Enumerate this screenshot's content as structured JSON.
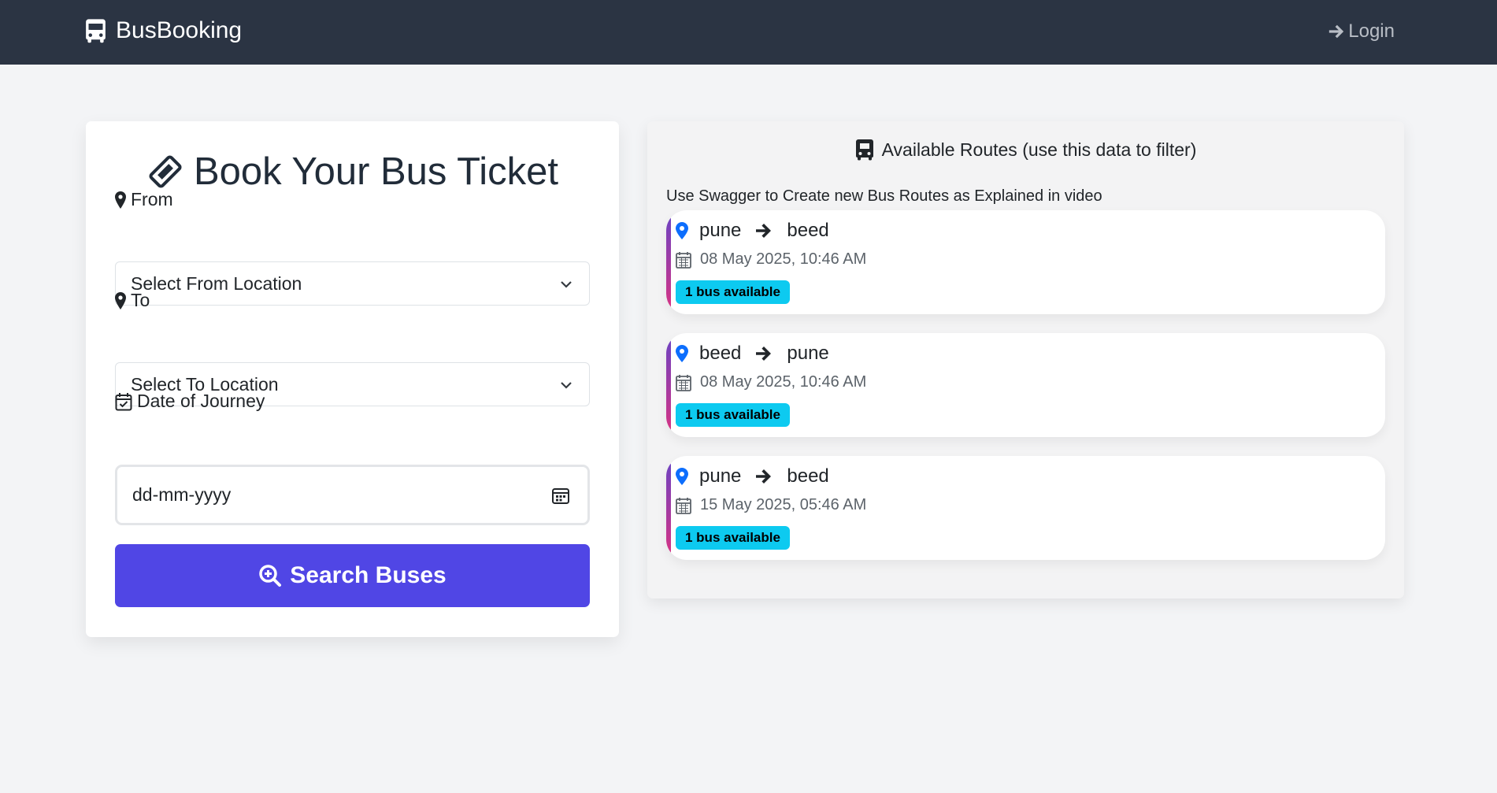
{
  "navbar": {
    "brand": "BusBooking",
    "login": "Login"
  },
  "booking": {
    "title": "Book Your Bus Ticket",
    "from_label": "From",
    "from_value": "Select From Location",
    "to_label": "To",
    "to_value": "Select To Location",
    "date_label": "Date of Journey",
    "date_placeholder": "dd-mm-yyyy",
    "search_label": "Search Buses"
  },
  "routes": {
    "title": "Available Routes (use this data to filter)",
    "note": "Use Swagger to Create new Bus Routes as Explained in video",
    "items": [
      {
        "from": "pune",
        "to": "beed",
        "datetime": "08 May 2025, 10:46 AM",
        "badge": "1 bus available"
      },
      {
        "from": "beed",
        "to": "pune",
        "datetime": "08 May 2025, 10:46 AM",
        "badge": "1 bus available"
      },
      {
        "from": "pune",
        "to": "beed",
        "datetime": "15 May 2025, 05:46 AM",
        "badge": "1 bus available"
      }
    ]
  },
  "colors": {
    "navbar": "#2b3443",
    "primary_button": "#5046e5",
    "badge": "#0dcaf0",
    "pin": "#0d6efd"
  },
  "icons": [
    "bus-icon",
    "sign-in-icon",
    "ticket-icon",
    "map-marker-icon",
    "calendar-check-icon",
    "chevron-down-icon",
    "calendar-icon",
    "search-plus-icon",
    "arrow-right-icon"
  ]
}
